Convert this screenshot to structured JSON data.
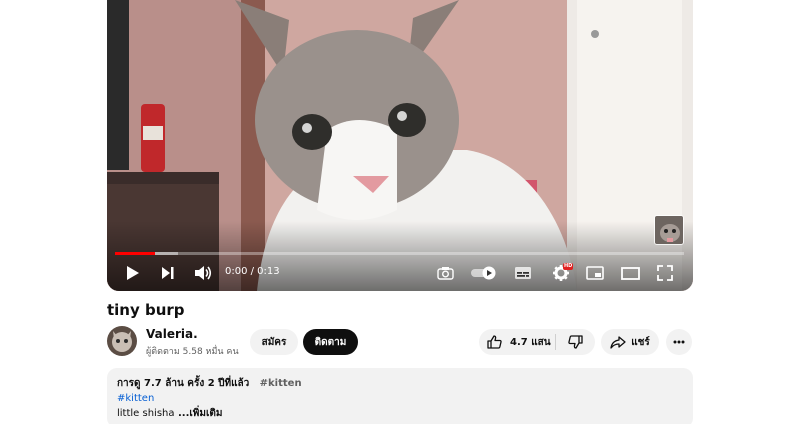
{
  "player": {
    "time_display": "0:00 / 0:13",
    "hd_badge": "HD",
    "progress_fraction": 0.07,
    "buffer_fraction": 0.11,
    "accent_color": "#ff0000"
  },
  "icons": {
    "play": "play-icon",
    "next": "skip-next-icon",
    "volume": "volume-icon",
    "screenshot": "camera-icon",
    "autoplay": "autoplay-toggle-icon",
    "subtitles": "subtitles-icon",
    "settings": "gear-icon",
    "miniplayer": "miniplayer-icon",
    "theater": "theater-mode-icon",
    "fullscreen": "fullscreen-icon",
    "like": "thumbs-up-icon",
    "dislike": "thumbs-down-icon",
    "share": "share-icon",
    "more": "more-icon"
  },
  "video": {
    "title": "tiny burp"
  },
  "channel": {
    "name": "Valeria.",
    "subscribers": "ผู้ติดตาม 5.58 หมื่น คน"
  },
  "actions": {
    "join_label": "สมัคร",
    "subscribe_label": "ติดตาม",
    "like_count": "4.7 แสน",
    "share_label": "แชร์"
  },
  "description": {
    "stats": "การดู 7.7 ล้าน ครั้ง  2 ปีที่แล้ว",
    "inline_tag": "#kitten",
    "hashtag_link": "#kitten",
    "text": "little shisha",
    "more_label": " ...เพิ่มเติม"
  }
}
